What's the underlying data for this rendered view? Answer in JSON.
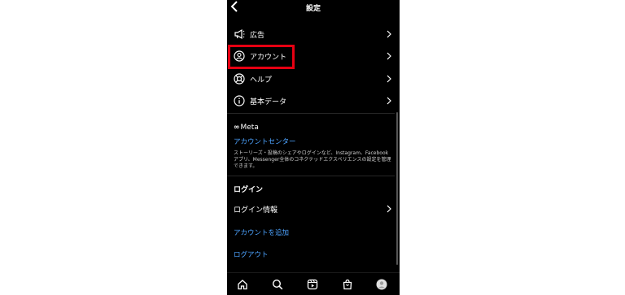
{
  "header": {
    "title": "設定"
  },
  "menu": [
    {
      "label": "広告",
      "icon": "megaphone-icon"
    },
    {
      "label": "アカウント",
      "icon": "account-circle-icon"
    },
    {
      "label": "ヘルプ",
      "icon": "lifebuoy-icon"
    },
    {
      "label": "基本データ",
      "icon": "info-icon"
    }
  ],
  "meta": {
    "logo": "Meta",
    "account_center": "アカウントセンター",
    "description": "ストーリーズ・投稿のシェアやログインなど、Instagram、Facebookアプリ、Messenger全体のコネクテッドエクスペリエンスの設定を管理できます。"
  },
  "login": {
    "section_title": "ログイン",
    "login_info": "ログイン情報",
    "add_account": "アカウントを追加",
    "logout": "ログアウト"
  },
  "nav": [
    "home-icon",
    "search-icon",
    "reels-icon",
    "shop-icon",
    "profile-icon"
  ],
  "colors": {
    "link": "#4da3ff",
    "highlight": "#e60012",
    "background": "#000000"
  }
}
